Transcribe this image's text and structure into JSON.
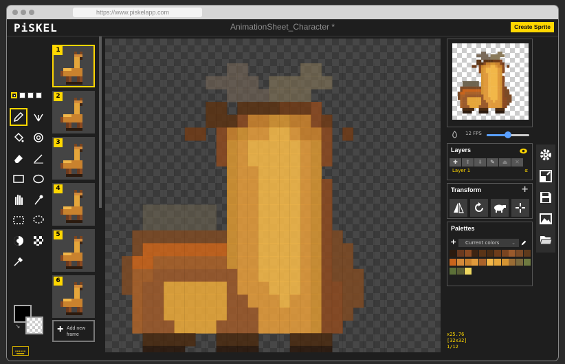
{
  "browser": {
    "url": "https://www.piskelapp.com"
  },
  "app": {
    "logo": "PiSKEL",
    "doc_title": "AnimationSheet_Character *",
    "create_button": "Create Sprite"
  },
  "frames": {
    "items": [
      {
        "label": "1"
      },
      {
        "label": "2"
      },
      {
        "label": "3"
      },
      {
        "label": "4"
      },
      {
        "label": "5"
      },
      {
        "label": "6"
      }
    ],
    "add_label_line1": "Add new",
    "add_label_line2": "frame"
  },
  "preview": {
    "fps_label": "12 FPS",
    "fps_value": 12
  },
  "layers": {
    "title": "Layers",
    "items": [
      {
        "name": "Layer 1",
        "alpha": "α"
      }
    ]
  },
  "transform": {
    "title": "Transform"
  },
  "palettes": {
    "title": "Palettes",
    "selected": "Current colors",
    "colors": [
      "#2b1a0e",
      "#6b3a1f",
      "#8a4a22",
      "#3d2412",
      "#5a3416",
      "#4a2c14",
      "#6e3c1a",
      "#7a4420",
      "#9a5a2c",
      "#7b4a26",
      "#5e3a1c",
      "#c8641c",
      "#d38a3a",
      "#c9822e",
      "#e09a3c",
      "#a9622a",
      "#f2b749",
      "#e5a63b",
      "#d49433",
      "#9a6d35",
      "#7a6a3e",
      "#6e7a40",
      "#5c7038",
      "#5a5f35",
      "#f0d860"
    ]
  },
  "status": {
    "coords": "x25.76",
    "size": "[32x32]",
    "frame": "1/12"
  },
  "colors": {
    "accent": "#ffd700",
    "primary": "#000000",
    "secondary": "transparent"
  },
  "tools": [
    "pen-icon",
    "vertical-mirror-pen-icon",
    "paint-bucket-icon",
    "magic-bucket-icon",
    "eraser-icon",
    "stroke-icon",
    "rectangle-icon",
    "ellipse-icon",
    "move-icon",
    "shape-selection-icon",
    "rectangle-selection-icon",
    "lasso-selection-icon",
    "lighten-icon",
    "dithering-icon",
    "color-picker-icon"
  ],
  "side_buttons": [
    "settings-icon",
    "resize-icon",
    "save-icon",
    "export-image-icon",
    "open-folder-icon"
  ]
}
